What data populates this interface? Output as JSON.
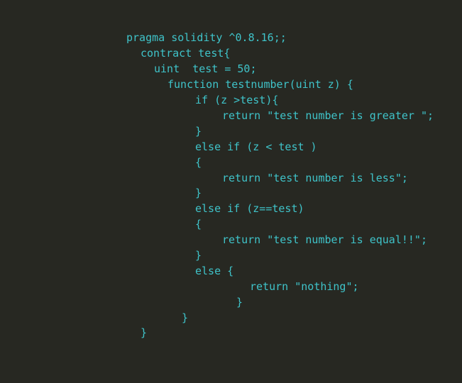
{
  "editor": {
    "colors": {
      "background": "#272822",
      "code_text": "#3fc3c9"
    },
    "lines": [
      "pragma solidity ^0.8.16;;",
      "contract test{",
      "uint  test = 50;",
      "function testnumber(uint z) {",
      "if (z >test){",
      "return \"test number is greater \";",
      "}",
      "else if (z < test )",
      "{",
      "return \"test number is less\";",
      "}",
      "else if (z==test)",
      "{",
      "return \"test number is equal!!\";",
      "}",
      "else {",
      "return \"nothing\";",
      "}",
      "}",
      "}"
    ]
  }
}
